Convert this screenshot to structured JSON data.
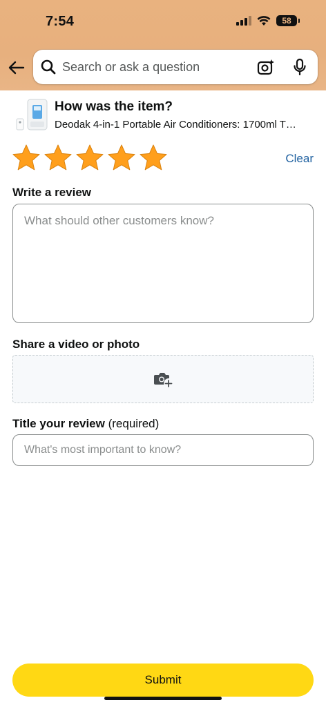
{
  "status_bar": {
    "time": "7:54",
    "battery": "58",
    "icons": [
      "cellular-signal-icon",
      "wifi-icon",
      "battery-icon"
    ]
  },
  "header": {
    "back_icon": "back-arrow-icon",
    "search": {
      "placeholder": "Search or ask a question",
      "icons": [
        "search-icon",
        "camera-icon",
        "microphone-icon"
      ]
    }
  },
  "product": {
    "heading": "How was the item?",
    "name": "Deodak 4-in-1 Portable Air Conditioners: 1700ml T…"
  },
  "rating": {
    "stars_selected": 5,
    "stars_total": 5,
    "star_color": "#ff9f1c",
    "clear_label": "Clear"
  },
  "review": {
    "label": "Write a review",
    "placeholder": "What should other customers know?",
    "value": ""
  },
  "media": {
    "label": "Share a video or photo",
    "icon": "camera-add-icon"
  },
  "title": {
    "label": "Title your review",
    "required_note": "(required)",
    "placeholder": "What's most important to know?",
    "value": ""
  },
  "submit": {
    "label": "Submit",
    "color": "#ffd814"
  },
  "colors": {
    "header_bg": "#e9b27f",
    "link": "#2162a1"
  }
}
